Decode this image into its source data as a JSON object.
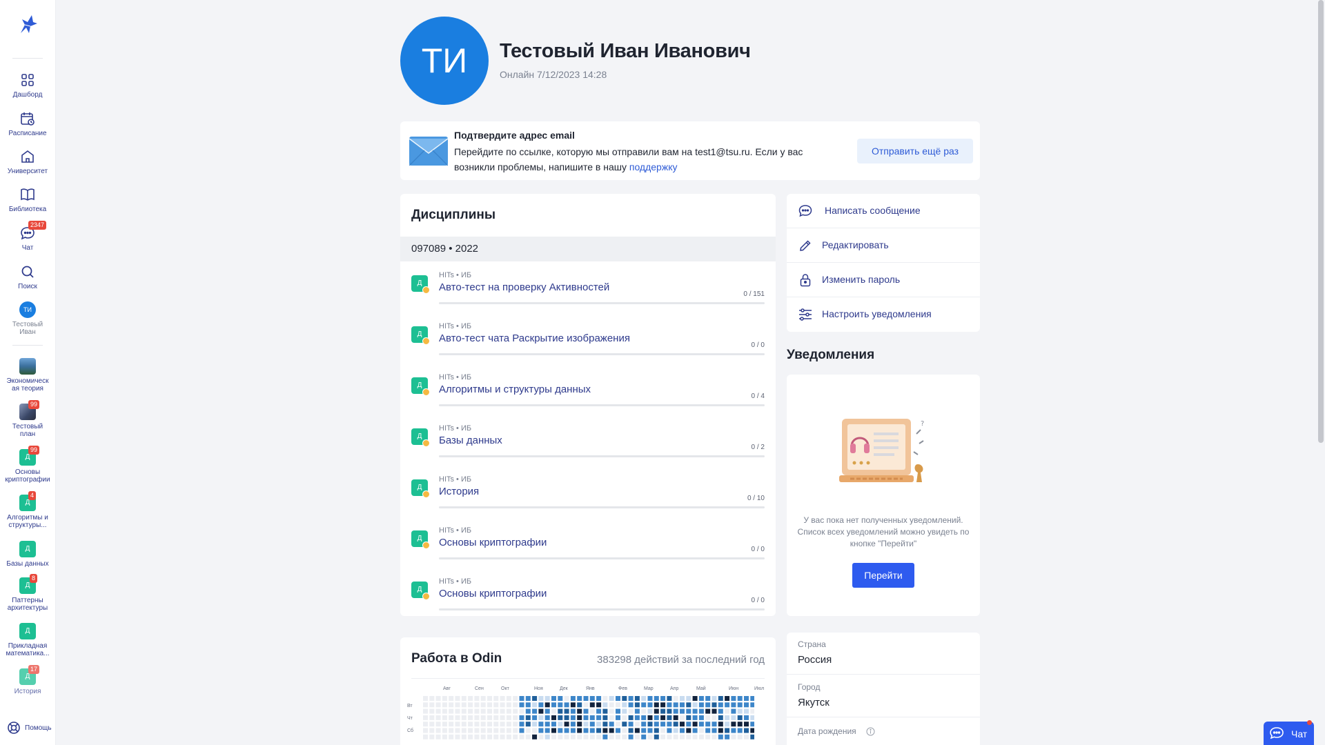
{
  "sidebar": {
    "nav": [
      {
        "label": "Дашборд",
        "icon": "dashboard-icon"
      },
      {
        "label": "Расписание",
        "icon": "schedule-icon"
      },
      {
        "label": "Университет",
        "icon": "university-icon"
      },
      {
        "label": "Библиотека",
        "icon": "library-icon"
      },
      {
        "label": "Чат",
        "icon": "chat-icon",
        "badge": "2347"
      },
      {
        "label": "Поиск",
        "icon": "search-icon"
      }
    ],
    "profile": {
      "initials": "ТИ",
      "label_line1": "Тестовый",
      "label_line2": "Иван"
    },
    "courses": [
      {
        "icon_text": "",
        "label_line1": "Экономическ",
        "label_line2": "ая теория",
        "badge": ""
      },
      {
        "icon_text": "",
        "label_line1": "Тестовый",
        "label_line2": "план",
        "badge": "99"
      },
      {
        "icon_text": "Д",
        "label_line1": "Основы",
        "label_line2": "криптографии",
        "badge": "99"
      },
      {
        "icon_text": "Д",
        "label_line1": "Алгоритмы и",
        "label_line2": "структуры...",
        "badge": "4"
      },
      {
        "icon_text": "Д",
        "label_line1": "Базы данных",
        "label_line2": "",
        "badge": ""
      },
      {
        "icon_text": "Д",
        "label_line1": "Паттерны",
        "label_line2": "архитектуры",
        "badge": "8"
      },
      {
        "icon_text": "Д",
        "label_line1": "Прикладная",
        "label_line2": "математика...",
        "badge": ""
      },
      {
        "icon_text": "Д",
        "label_line1": "История",
        "label_line2": "",
        "badge": "17"
      }
    ],
    "help_label": "Помощь"
  },
  "profile": {
    "initials": "ТИ",
    "name": "Тестовый Иван Иванович",
    "status": "Онлайн 7/12/2023 14:28"
  },
  "email_notice": {
    "title": "Подтвердите адрес email",
    "text": "Перейдите по ссылке, которую мы отправили вам на test1@tsu.ru. Если у вас возникли проблемы, напишите в нашу ",
    "link": "поддержку",
    "resend_label": "Отправить ещё раз"
  },
  "disciplines": {
    "title": "Дисциплины",
    "group": "097089 • 2022",
    "items": [
      {
        "icon_text": "Д",
        "meta": "HITs • ИБ",
        "name": "Авто-тест на проверку Активностей",
        "count": "0 / 151"
      },
      {
        "icon_text": "Д",
        "meta": "HITs • ИБ",
        "name": "Авто-тест чата Раскрытие изображения",
        "count": "0 / 0"
      },
      {
        "icon_text": "Д",
        "meta": "HITs • ИБ",
        "name": "Алгоритмы и структуры данных",
        "count": "0 / 4"
      },
      {
        "icon_text": "Д",
        "meta": "HITs • ИБ",
        "name": "Базы данных",
        "count": "0 / 2"
      },
      {
        "icon_text": "Д",
        "meta": "HITs • ИБ",
        "name": "История",
        "count": "0 / 10"
      },
      {
        "icon_text": "Д",
        "meta": "HITs • ИБ",
        "name": "Основы криптографии",
        "count": "0 / 0"
      },
      {
        "icon_text": "Д",
        "meta": "HITs • ИБ",
        "name": "Основы криптографии",
        "count": "0 / 0"
      }
    ]
  },
  "actions": [
    {
      "label": "Написать сообщение",
      "icon": "message-icon"
    },
    {
      "label": "Редактировать",
      "icon": "edit-icon"
    },
    {
      "label": "Изменить пароль",
      "icon": "lock-icon"
    },
    {
      "label": "Настроить уведомления",
      "icon": "settings-sliders-icon"
    }
  ],
  "notifications": {
    "title": "Уведомления",
    "empty_text": "У вас пока нет полученных уведомлений. Список всех уведомлений можно увидеть по кнопке \"Перейти\"",
    "button_label": "Перейти"
  },
  "odin": {
    "title": "Работа в Odin",
    "stat": "383298 действий за последний год",
    "months": [
      "Авг",
      "Сен",
      "Окт",
      "Ноя",
      "Дек",
      "Янв",
      "Фев",
      "Мар",
      "Апр",
      "Май",
      "Июн",
      "Июл"
    ],
    "days": [
      "Вт",
      "Чт",
      "Сб"
    ]
  },
  "info": {
    "fields": [
      {
        "label": "Страна",
        "value": "Россия"
      },
      {
        "label": "Город",
        "value": "Якутск"
      },
      {
        "label": "Дата рождения",
        "value": ""
      }
    ]
  },
  "chat_widget": {
    "label": "Чат"
  },
  "colors": {
    "accent": "#2e5bef",
    "link": "#2e3a8c",
    "avatar": "#1a7ee0",
    "course": "#1dbf93",
    "badge": "#e8483b"
  }
}
